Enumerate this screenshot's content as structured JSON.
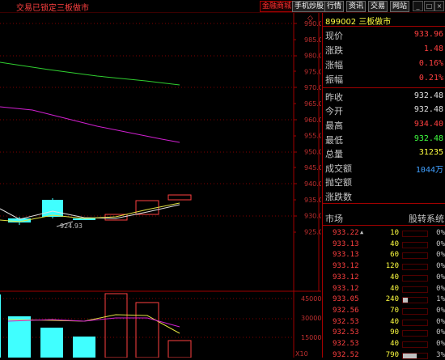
{
  "topbar": {
    "status": "交易已锁定",
    "market": "三板做市",
    "buttons": [
      "金融商城",
      "手机炒股",
      "行情",
      "资讯",
      "交易",
      "网站"
    ]
  },
  "chart": {
    "price_ticks": [
      "990.0",
      "985.0",
      "980.0",
      "975.0",
      "970.0",
      "965.0",
      "960.0",
      "955.0",
      "950.0",
      "945.0",
      "940.0",
      "935.0",
      "930.0",
      "925.0"
    ],
    "volume_ticks": [
      "45000",
      "30000",
      "15000"
    ],
    "low_label": "924.93",
    "multiplier_label": "X10",
    "diamond": "◇"
  },
  "quote": {
    "code": "899002",
    "name": "三板做市",
    "rows": [
      {
        "label": "现价",
        "value": "933.96",
        "color": "#ff4040"
      },
      {
        "label": "涨跌",
        "value": "1.48",
        "color": "#ff4040"
      },
      {
        "label": "涨幅",
        "value": "0.16%",
        "color": "#ff4040"
      },
      {
        "label": "振幅",
        "value": "0.21%",
        "color": "#ff4040"
      },
      {
        "label": "昨收",
        "value": "932.48",
        "color": "#e0e0e0"
      },
      {
        "label": "今开",
        "value": "932.48",
        "color": "#e0e0e0"
      },
      {
        "label": "最高",
        "value": "934.40",
        "color": "#ff4040"
      },
      {
        "label": "最低",
        "value": "932.48",
        "color": "#40ff40"
      },
      {
        "label": "总量",
        "value": "31235",
        "color": "#ffff40"
      },
      {
        "label": "成交额",
        "value": "1044万",
        "color": "#40a0ff"
      },
      {
        "label": "抛空额",
        "value": "",
        "color": "#e0e0e0"
      },
      {
        "label": "涨跌数",
        "value": "",
        "color": "#e0e0e0"
      }
    ],
    "market_label": "市场",
    "system_label": "股转系统"
  },
  "ticks": [
    {
      "price": "933.22",
      "arrow": "▲",
      "vol": "10",
      "bar": 0.0,
      "pct": "0%"
    },
    {
      "price": "933.13",
      "arrow": "",
      "vol": "40",
      "bar": 0.0,
      "pct": "0%"
    },
    {
      "price": "933.13",
      "arrow": "",
      "vol": "60",
      "bar": 0.0,
      "pct": "0%"
    },
    {
      "price": "933.12",
      "arrow": "",
      "vol": "120",
      "bar": 0.0,
      "pct": "0%"
    },
    {
      "price": "933.12",
      "arrow": "",
      "vol": "40",
      "bar": 0.0,
      "pct": "0%"
    },
    {
      "price": "933.12",
      "arrow": "",
      "vol": "40",
      "bar": 0.0,
      "pct": "0%"
    },
    {
      "price": "933.05",
      "arrow": "",
      "vol": "240",
      "bar": 0.2,
      "pct": "1%"
    },
    {
      "price": "932.56",
      "arrow": "",
      "vol": "70",
      "bar": 0.0,
      "pct": "0%"
    },
    {
      "price": "932.53",
      "arrow": "",
      "vol": "40",
      "bar": 0.0,
      "pct": "0%"
    },
    {
      "price": "932.53",
      "arrow": "",
      "vol": "90",
      "bar": 0.0,
      "pct": "0%"
    },
    {
      "price": "932.53",
      "arrow": "",
      "vol": "40",
      "bar": 0.0,
      "pct": "0%"
    },
    {
      "price": "932.52",
      "arrow": "",
      "vol": "790",
      "bar": 0.55,
      "pct": "3%"
    }
  ],
  "colors": {
    "up": "#ff4040",
    "down": "#40ffff",
    "flat": "#e0e0e0",
    "grid": "#800000"
  }
}
